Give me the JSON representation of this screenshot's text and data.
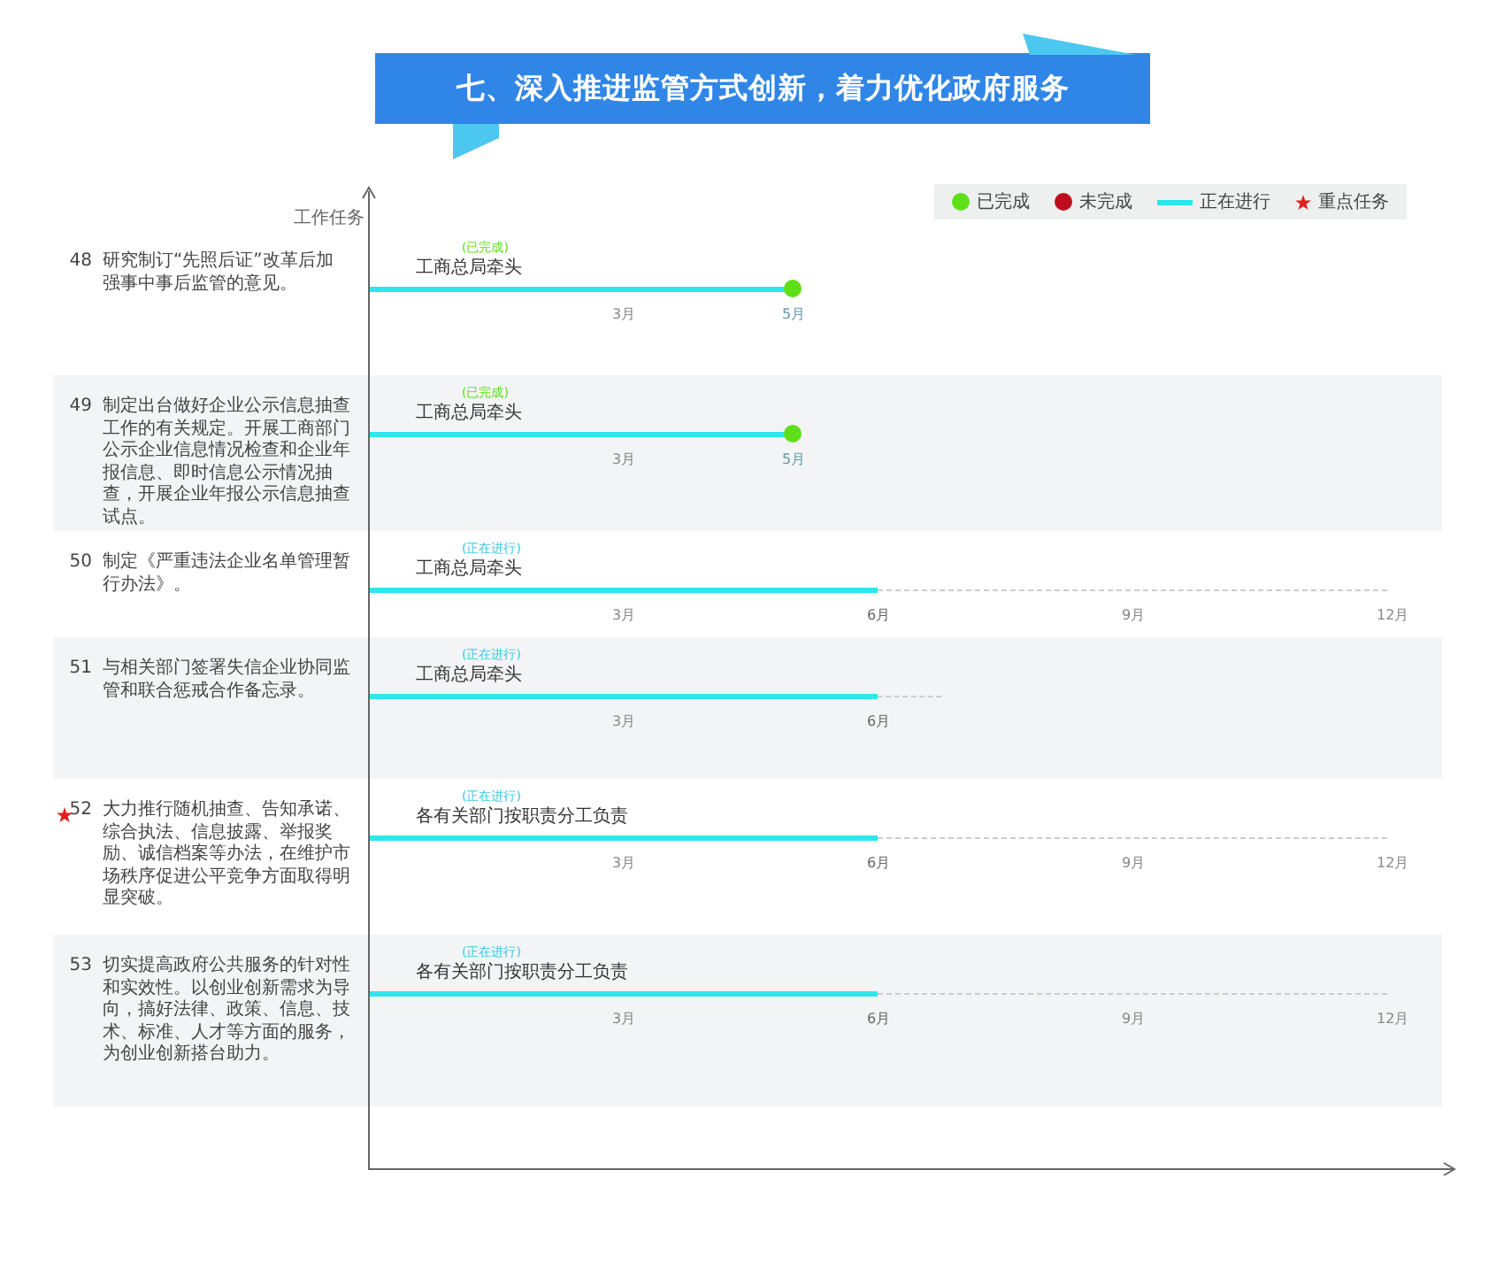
{
  "title": "七、深入推进监管方式创新，着力优化政府服务",
  "y_axis_label": "工作任务",
  "legend": [
    {
      "kind": "dot",
      "color": "#5ee018",
      "label": "已完成"
    },
    {
      "kind": "dot",
      "color": "#c00d1e",
      "label": "未完成"
    },
    {
      "kind": "line",
      "color": "#2de6ee",
      "label": "正在进行"
    },
    {
      "kind": "star",
      "color": "#e02020",
      "label": "重点任务"
    }
  ],
  "rows": [
    {
      "number": "48",
      "key": false,
      "text": "研究制订“先照后证”改革后加强事中事后监管的意见。",
      "kind": "done",
      "status_label": "(已完成)",
      "lead": "工商总局牵头",
      "ticks": [
        {
          "label": "3月",
          "bar_end": false
        },
        {
          "label": "5月",
          "bar_end": true
        }
      ]
    },
    {
      "number": "49",
      "key": false,
      "text": "制定出台做好企业公示信息抽查工作的有关规定。开展工商部门公示企业信息情况检查和企业年报信息、即时信息公示情况抽查，开展企业年报公示信息抽查试点。",
      "kind": "done",
      "status_label": "(已完成)",
      "lead": "工商总局牵头",
      "ticks": [
        {
          "label": "3月",
          "bar_end": false
        },
        {
          "label": "5月",
          "bar_end": true
        }
      ]
    },
    {
      "number": "50",
      "key": false,
      "text": "制定《严重违法企业名单管理暂行办法》。",
      "kind": "ongoing",
      "status_label": "(正在进行)",
      "lead": "工商总局牵头",
      "ticks": [
        {
          "label": "3月",
          "bar_end": false
        },
        {
          "label": "6月",
          "bar_end": true
        },
        {
          "label": "9月",
          "bar_end": false
        },
        {
          "label": "12月",
          "bar_end": false
        }
      ]
    },
    {
      "number": "51",
      "key": false,
      "text": "与相关部门签署失信企业协同监管和联合惩戒合作备忘录。",
      "kind": "ongoing",
      "status_label": "(正在进行)",
      "lead": "工商总局牵头",
      "ticks": [
        {
          "label": "3月",
          "bar_end": false
        },
        {
          "label": "6月",
          "bar_end": true
        }
      ]
    },
    {
      "number": "52",
      "key": true,
      "text": "大力推行随机抽查、告知承诺、综合执法、信息披露、举报奖励、诚信档案等办法，在维护市场秩序促进公平竞争方面取得明显突破。",
      "kind": "ongoing",
      "status_label": "(正在进行)",
      "lead": "各有关部门按职责分工负责",
      "ticks": [
        {
          "label": "3月",
          "bar_end": false
        },
        {
          "label": "6月",
          "bar_end": true
        },
        {
          "label": "9月",
          "bar_end": false
        },
        {
          "label": "12月",
          "bar_end": false
        }
      ]
    },
    {
      "number": "53",
      "key": false,
      "text": "切实提高政府公共服务的针对性和实效性。以创业创新需求为导向，搞好法律、政策、信息、技术、标准、人才等方面的服务，为创业创新搭台助力。",
      "kind": "ongoing",
      "status_label": "(正在进行)",
      "lead": "各有关部门按职责分工负责",
      "ticks": [
        {
          "label": "3月",
          "bar_end": false
        },
        {
          "label": "6月",
          "bar_end": true
        },
        {
          "label": "9月",
          "bar_end": false
        },
        {
          "label": "12月",
          "bar_end": false
        }
      ]
    }
  ]
}
